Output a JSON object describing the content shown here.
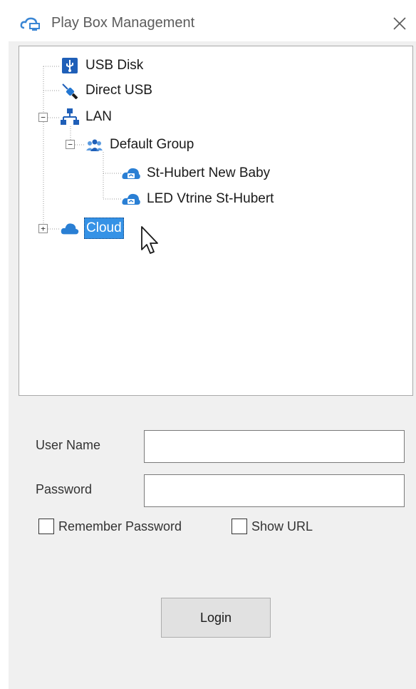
{
  "window": {
    "title": "Play Box Management",
    "app_icon": "cloud-screen-icon",
    "close_icon": "close-icon"
  },
  "tree": {
    "nodes": [
      {
        "label": "USB Disk",
        "icon": "usb-disk-icon",
        "level": 0
      },
      {
        "label": "Direct USB",
        "icon": "usb-cable-icon",
        "level": 0
      },
      {
        "label": "LAN",
        "icon": "network-icon",
        "level": 0,
        "expander": "minus"
      },
      {
        "label": "Default Group",
        "icon": "group-icon",
        "level": 1,
        "expander": "minus"
      },
      {
        "label": "St-Hubert New Baby",
        "icon": "player-device-icon",
        "level": 2
      },
      {
        "label": "LED Vtrine St-Hubert",
        "icon": "player-device-icon",
        "level": 2
      },
      {
        "label": "Cloud",
        "icon": "cloud-icon",
        "level": 0,
        "expander": "plus",
        "selected": true
      }
    ]
  },
  "form": {
    "username_label": "User Name",
    "username_value": "",
    "password_label": "Password",
    "password_value": "",
    "remember_password_label": "Remember Password",
    "remember_password_checked": false,
    "show_url_label": "Show URL",
    "show_url_checked": false,
    "login_label": "Login"
  },
  "colors": {
    "selection": "#3592e6",
    "icon_blue": "#1f73c8",
    "client_bg": "#f0f0f0"
  }
}
